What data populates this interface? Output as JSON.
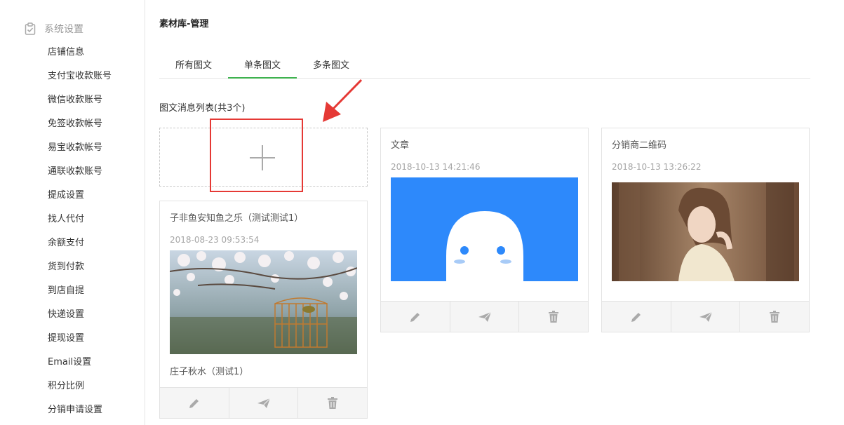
{
  "sidebar": {
    "section_label": "系统设置",
    "items": [
      {
        "label": "店铺信息"
      },
      {
        "label": "支付宝收款账号"
      },
      {
        "label": "微信收款账号"
      },
      {
        "label": "免签收款帐号"
      },
      {
        "label": "易宝收款帐号"
      },
      {
        "label": "通联收款账号"
      },
      {
        "label": "提成设置"
      },
      {
        "label": "找人代付"
      },
      {
        "label": "余额支付"
      },
      {
        "label": "货到付款"
      },
      {
        "label": "到店自提"
      },
      {
        "label": "快递设置"
      },
      {
        "label": "提现设置"
      },
      {
        "label": "Email设置"
      },
      {
        "label": "积分比例"
      },
      {
        "label": "分销申请设置"
      }
    ]
  },
  "header": {
    "title": "素材库-管理"
  },
  "tabs": [
    {
      "label": "所有图文",
      "active": false
    },
    {
      "label": "单条图文",
      "active": true
    },
    {
      "label": "多条图文",
      "active": false
    }
  ],
  "list": {
    "title": "图文消息列表(共3个)"
  },
  "cards": [
    {
      "title": "子非鱼安知鱼之乐（测试测试1）",
      "date": "2018-08-23 09:53:54",
      "caption": "庄子秋水（测试1）",
      "image": "blossom-birdcage-photo"
    },
    {
      "title": "文章",
      "date": "2018-10-13 14:21:46",
      "caption": "",
      "image": "blue-ghost-logo"
    },
    {
      "title": "分销商二维码",
      "date": "2018-10-13 13:26:22",
      "caption": "",
      "image": "woman-portrait-photo"
    }
  ],
  "icons": {
    "edit": "pencil-icon",
    "send": "paper-plane-icon",
    "delete": "trash-icon",
    "add": "plus-icon"
  },
  "colors": {
    "tab_active": "#3fb24f",
    "annotation": "#e53935",
    "ghost_bg": "#2d89fb"
  }
}
